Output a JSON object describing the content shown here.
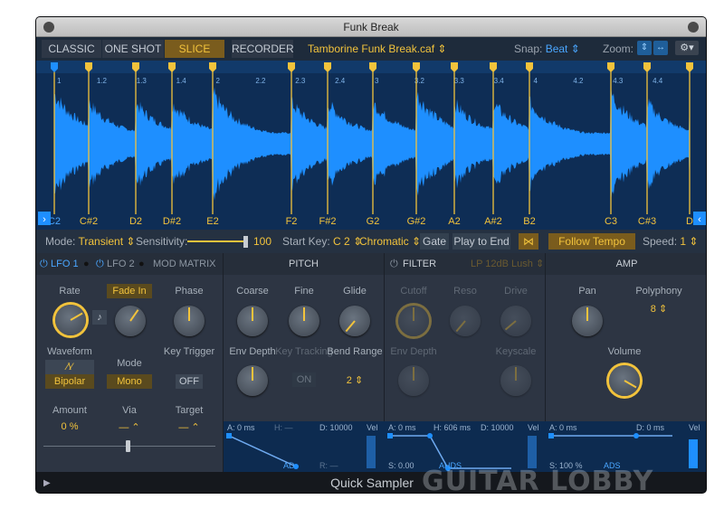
{
  "window": {
    "title": "Funk Break"
  },
  "modes": [
    {
      "label": "CLASSIC",
      "active": false
    },
    {
      "label": "ONE SHOT",
      "active": false
    },
    {
      "label": "SLICE",
      "active": true
    }
  ],
  "recorder_label": "RECORDER",
  "file": {
    "name": "Tamborine Funk Break.caf",
    "chevron": "⌃"
  },
  "snap": {
    "label": "Snap:",
    "value": "Beat"
  },
  "zoom": {
    "label": "Zoom:"
  },
  "waveform": {
    "ruler": [
      "1",
      "1.2",
      "1.3",
      "1.4",
      "2",
      "2.2",
      "2.3",
      "2.4",
      "3",
      "3.2",
      "3.3",
      "3.4",
      "4",
      "4.2",
      "4.3",
      "4.4"
    ],
    "notes": [
      "C2",
      "C#2",
      "D2",
      "D#2",
      "E2",
      "F2",
      "F#2",
      "G2",
      "G#2",
      "A2",
      "A#2",
      "B2",
      "C3",
      "C#3",
      "D"
    ]
  },
  "modebar": {
    "mode_label": "Mode:",
    "mode_value": "Transient",
    "sensitivity_label": "Sensitivity:",
    "sensitivity_value": "100",
    "startkey_label": "Start Key:",
    "startkey_value": "C 2",
    "scale_value": "Chromatic",
    "gate": "Gate",
    "play_to_end": "Play to End",
    "follow_tempo": "Follow Tempo",
    "speed_label": "Speed:",
    "speed_value": "1"
  },
  "lfo": {
    "tab1": "LFO 1",
    "tab2": "LFO 2",
    "tab3": "MOD MATRIX",
    "rate": "Rate",
    "fade_in": "Fade In",
    "phase": "Phase",
    "waveform": "Waveform",
    "polarity": "Bipolar",
    "mode": "Mode",
    "mode_value": "Mono",
    "key_trigger": "Key Trigger",
    "key_trigger_value": "OFF",
    "amount": "Amount",
    "amount_value": "0 %",
    "via": "Via",
    "via_value": "— ⌃",
    "target": "Target",
    "target_value": "— ⌃"
  },
  "pitch": {
    "title": "PITCH",
    "coarse": "Coarse",
    "fine": "Fine",
    "glide": "Glide",
    "env_depth": "Env Depth",
    "key_tracking": "Key Tracking",
    "key_tracking_value": "ON",
    "bend_range": "Bend Range",
    "bend_value": "2",
    "env": {
      "a": "A: 0 ms",
      "h": "H: —",
      "d": "D: 10000",
      "vel": "Vel",
      "ad": "AD",
      "r": "R: —"
    }
  },
  "filter": {
    "title": "FILTER",
    "type": "LP 12dB Lush",
    "cutoff": "Cutoff",
    "reso": "Reso",
    "drive": "Drive",
    "env_depth": "Env Depth",
    "keyscale": "Keyscale",
    "env": {
      "a": "A: 0 ms",
      "h": "H: 606 ms",
      "d": "D: 10000",
      "vel": "Vel",
      "ahds": "AHDS",
      "s": "S: 0.00"
    }
  },
  "amp": {
    "title": "AMP",
    "pan": "Pan",
    "polyphony": "Polyphony",
    "polyphony_value": "8",
    "volume": "Volume",
    "env": {
      "a": "A: 0 ms",
      "d": "D: 0 ms",
      "vel": "Vel",
      "ads": "ADS",
      "s": "S: 100 %"
    }
  },
  "footer": {
    "title": "Quick Sampler",
    "watermark": "GUITAR LOBBY"
  },
  "colors": {
    "accent": "#f2c33c",
    "wave": "#1e8fff",
    "wave_bg": "#0e2d55"
  }
}
